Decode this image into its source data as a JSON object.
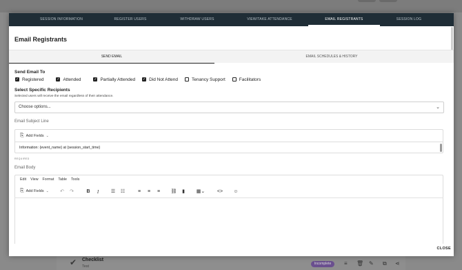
{
  "background": {
    "checklist_title": "Checklist",
    "checklist_sub": "Test",
    "status_badge": "Incomplete"
  },
  "tabs": [
    {
      "label": "SESSION INFORMATION"
    },
    {
      "label": "REGISTER USERS"
    },
    {
      "label": "WITHDRAW USERS"
    },
    {
      "label": "VIEW/TAKE ATTENDANCE"
    },
    {
      "label": "EMAIL REGISTRANTS",
      "active": true
    },
    {
      "label": "SESSION LOG"
    }
  ],
  "modal": {
    "title": "Email Registrants",
    "subtabs": [
      {
        "label": "SEND EMAIL",
        "active": true
      },
      {
        "label": "EMAIL SCHEDULES & HISTORY"
      }
    ],
    "close_label": "CLOSE"
  },
  "send_to": {
    "label": "Send Email To",
    "options": [
      {
        "label": "Registered",
        "checked": true
      },
      {
        "label": "Attended",
        "checked": true
      },
      {
        "label": "Partially Attended",
        "checked": true
      },
      {
        "label": "Did Not Attend",
        "checked": true
      },
      {
        "label": "Tenancy Support",
        "checked": false
      },
      {
        "label": "Facilitators",
        "checked": false
      }
    ]
  },
  "recipients": {
    "label": "Select Specific Recipients",
    "note": "Selected users will receive the email regardless of their attendance.",
    "placeholder": "Choose options..."
  },
  "subject": {
    "label": "Email Subject Line",
    "add_fields": "Add Fields",
    "value": "Information: {event_name} at {session_start_time}",
    "required": "REQUIRED"
  },
  "body": {
    "label": "Email Body",
    "menu": [
      "Edit",
      "View",
      "Format",
      "Table",
      "Tools"
    ],
    "add_fields": "Add Fields"
  },
  "icons": {
    "checkmark": "✓",
    "chevron": "⌄",
    "add_fields": "⎘"
  }
}
